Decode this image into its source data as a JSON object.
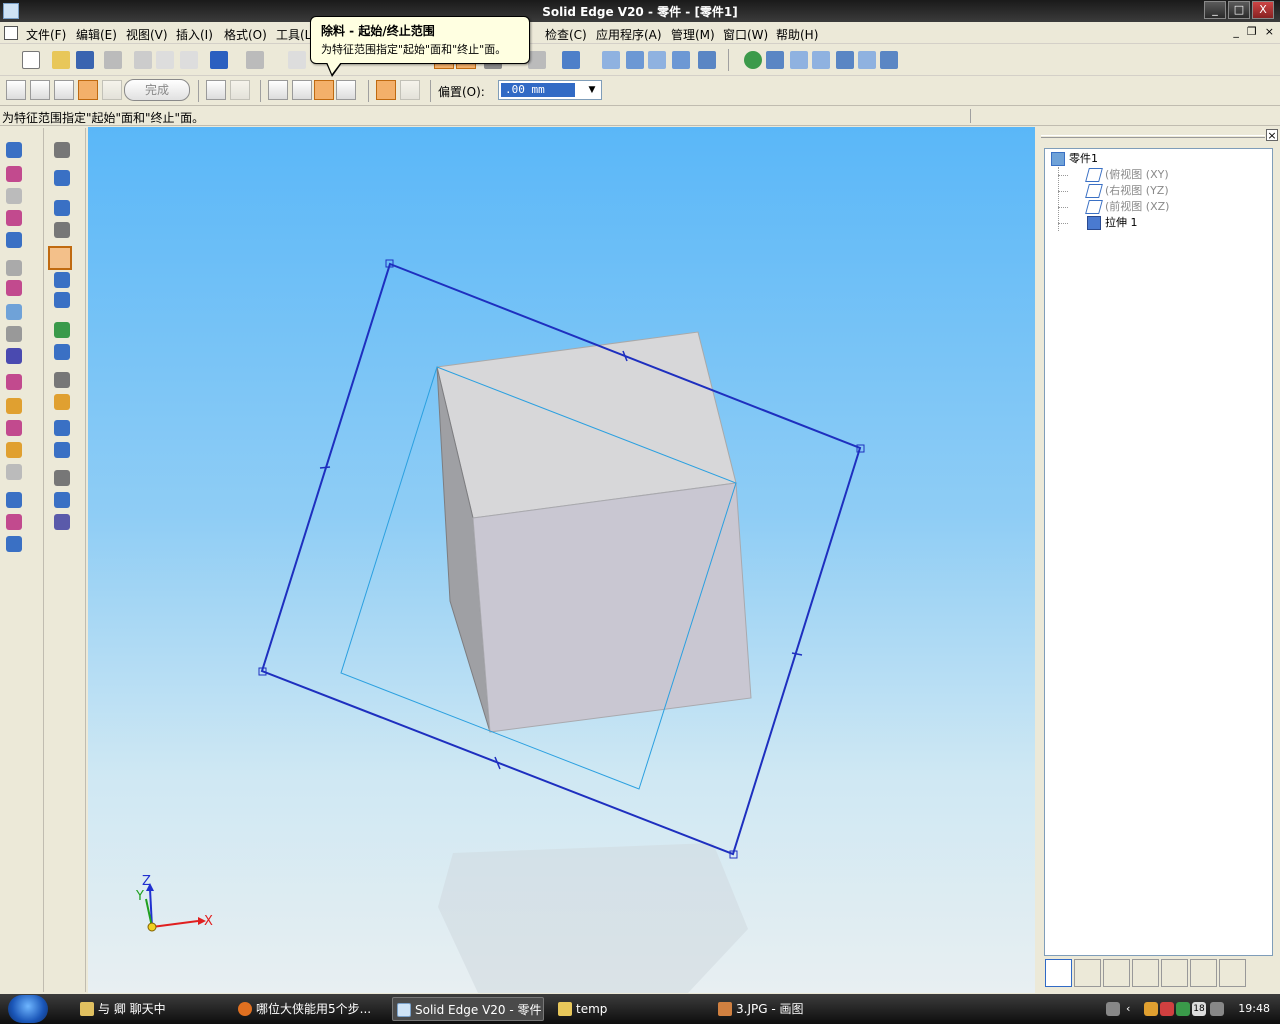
{
  "window": {
    "title": "Solid Edge V20 - 零件 - [零件1]",
    "min": "_",
    "max": "□",
    "close": "X"
  },
  "menu": {
    "items": [
      "文件(F)",
      "编辑(E)",
      "视图(V)",
      "插入(I)",
      "格式(O)",
      "工具(L",
      "检查(C)",
      "应用程序(A)",
      "管理(M)",
      "窗口(W)",
      "帮助(H)"
    ],
    "mdi_min": "_",
    "mdi_restore": "❐",
    "mdi_close": "×"
  },
  "toolbar2": {
    "finish_label": "完成",
    "offset_label": "偏置(O):",
    "offset_value": ".00 mm"
  },
  "tooltip": {
    "title": "除料 - 起始/终止范围",
    "body": "为特征范围指定\"起始\"面和\"终止\"面。"
  },
  "prompt_text": "为特征范围指定\"起始\"面和\"终止\"面。",
  "triad": {
    "z": "Z",
    "y": "Y",
    "x": "X"
  },
  "pathfinder": {
    "close": "×",
    "root": "零件1",
    "items": [
      {
        "label": "(俯视图 (XY)",
        "dim": true,
        "icon": "plane-icon"
      },
      {
        "label": "(右视图 (YZ)",
        "dim": true,
        "icon": "plane-icon"
      },
      {
        "label": "(前视图 (XZ)",
        "dim": true,
        "icon": "plane-icon"
      },
      {
        "label": "拉伸 1",
        "dim": false,
        "icon": "protrusion-icon"
      }
    ]
  },
  "taskbar": {
    "tasks": [
      {
        "label": "与 卿 聊天中",
        "active": false
      },
      {
        "label": "哪位大侠能用5个步...",
        "active": false
      },
      {
        "label": "Solid Edge V20 - 零件 ...",
        "active": true
      },
      {
        "label": "temp",
        "active": false
      },
      {
        "label": "3.JPG - 画图",
        "active": false
      }
    ],
    "clock": "19:48",
    "tray_badge": "18"
  },
  "colors": {
    "profile_blue": "#1e2fbf",
    "sketch_cyan": "#2ba0e0",
    "highlight_orange": "#f3b06a"
  }
}
